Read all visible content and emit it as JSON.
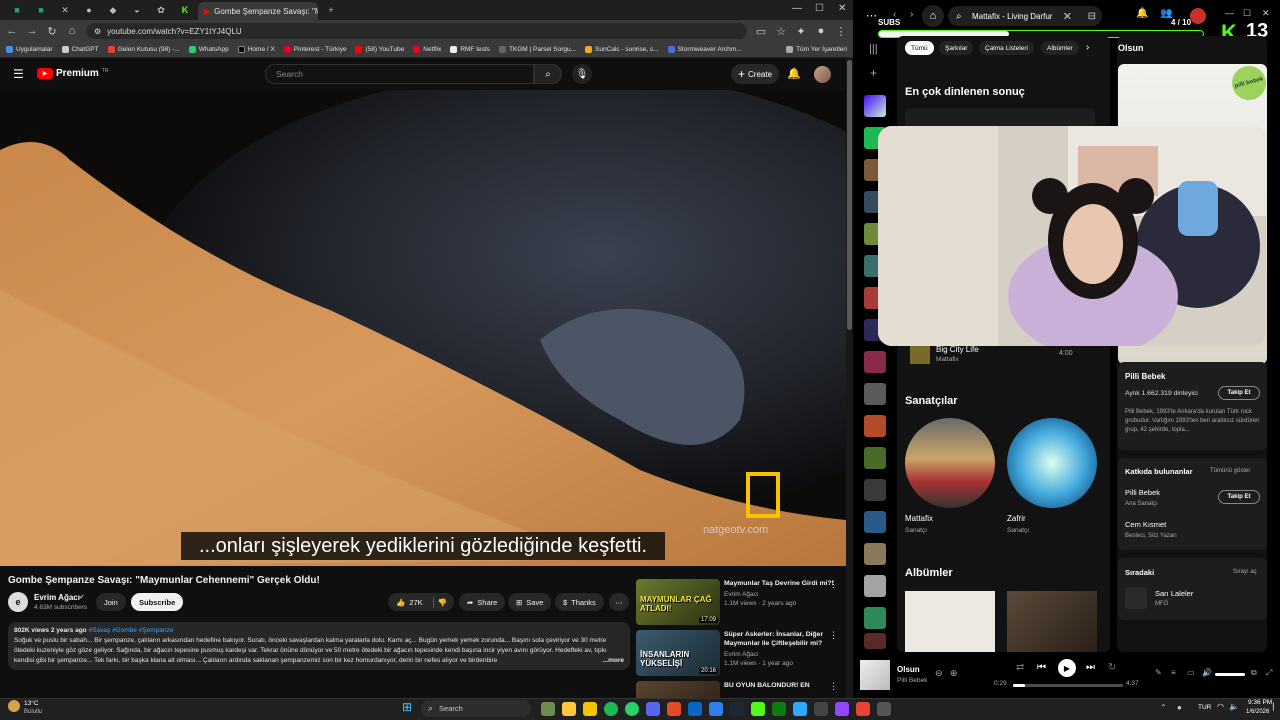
{
  "browser": {
    "tab_title": "Gombe Şempanze Savaşı: \"M",
    "url": "youtube.com/watch?v=EZY1tYJ4QLU",
    "bookmarks": [
      "Uygulamalar",
      "ChatGPT",
      "Gelen Kutusu (98) -...",
      "WhatsApp",
      "Home / X",
      "Pinterest - Türkiye",
      "(58) YouTube",
      "Netflix",
      "RMF tests",
      "TKGM | Parsel Sorgu...",
      "SunCalc - sunrise, s...",
      "Stormweaver Archm..."
    ],
    "all_bookmarks": "Tüm Yer İşaretleri"
  },
  "youtube": {
    "logo": "Premium",
    "logo_sup": "TR",
    "search_placeholder": "Search",
    "create_label": "Create",
    "subtitle": "...onları şişleyerek yediklerini gözlediğinde keşfetti.",
    "watermark": "natgeotv.com",
    "video_title": "Gombe Şempanze Savaşı: \"Maymunlar Cehennemi\" Gerçek Oldu!",
    "channel_name": "Evrim Ağacı",
    "channel_subs": "4.63M subscribers",
    "join_label": "Join",
    "subscribe_label": "Subscribe",
    "likes": "27K",
    "share_label": "Share",
    "save_label": "Save",
    "thanks_label": "Thanks",
    "desc_meta": "802K views  2 years ago",
    "desc_tags": "#Savaş #Gombe #Şempanze",
    "desc_body": "Soğuk ve puslu bir sabah... Bir şempanze, çalıların arkasından hedefine bakıyor. Suratı, önceki savaşlardan kalma yaralarla dolu. Kamı aç... Bugün yemek yemek zorunda... Başını sola çeviriyor ve 30 metre ötedeki kuzeniyle göz göze geliyor. Sağında, bir ağacın tepesine pusmuş kardeşi var. Tekrar önüne dönüyor ve 50 metre ötedeki bir ağacın tepesinde kendi başına incir yiyen avını görüyor. Hedefteki av, tıpkı kendisi gibi bir şempanze... Tek farkı, bir başka klana ait olması... Çalıların ardında saklanan şempanzemiz son bir kez homurdanıyor, derin bir nefes alıyor ve birdenbire",
    "desc_more": "...more",
    "recs": [
      {
        "thumb_text": "MAYMUNLAR ÇAĞ ATLADI!",
        "duration": "17:09",
        "title": "Maymunlar Taş Devrine Girdi mi?!",
        "channel": "Evrim Ağacı",
        "meta": "1.1M views · 2 years ago",
        "color": "#5a6b2a"
      },
      {
        "thumb_text": "İNSANLARIN YÜKSELİŞİ",
        "duration": "20:16",
        "title": "Süper Askerler: İnsanlar, Diğer Maymunlar ile Çiftleşebilir mi?",
        "channel": "Evrim Ağacı",
        "meta": "1.1M views · 1 year ago",
        "color": "#2e4a5c"
      },
      {
        "thumb_text": "",
        "duration": "",
        "title": "BU OYUN BALONDUR! EN",
        "channel": "",
        "meta": "",
        "color": "#4a3a2a"
      }
    ]
  },
  "overlay": {
    "subs_label": "SUBS",
    "subs_count": "4 / 10",
    "kick_count": "13",
    "subs_progress": 0.4
  },
  "spotify": {
    "search_value": "Mattafix - Living Darfur",
    "chips": [
      "Tümü",
      "Şarkılar",
      "Çalma Listeleri",
      "Albümler"
    ],
    "top_result_heading": "En çok dinlenen sonuç",
    "song_title": "Big City Life",
    "song_artist": "Mattafix",
    "song_duration": "4:00",
    "artists_heading": "Sanatçılar",
    "artists": [
      {
        "name": "Mattafix",
        "type": "Sanatçı"
      },
      {
        "name": "Zafrir",
        "type": "Sanatçı"
      }
    ],
    "albums_heading": "Albümler",
    "side_title": "Olsun",
    "side_brand": "pilli bebek",
    "band_name": "Pilli Bebek",
    "monthly_listeners": "Aylık 1.662.319 dinleyici",
    "follow_label": "Takip Et",
    "band_bio": "Pilli Bebek, 1993'te Ankara'da kurulan Türk rock grubudur. Varlığını 1993'ten beri aralıksız sürdüren grup, 42 şehirde, topla...",
    "contributors_heading": "Katkıda bulunanlar",
    "show_all": "Tümünü göster",
    "contributors": [
      {
        "name": "Pilli Bebek",
        "role": "Ana Sanatçı"
      },
      {
        "name": "Cem Kısmet",
        "role": "Besteci, Söz Yazarı"
      }
    ],
    "queue_heading": "Sıradaki",
    "queue_open": "Sırayı aç",
    "queue_track": "Sarı Laleler",
    "queue_artist": "MFÖ",
    "now_playing_title": "Olsun",
    "now_playing_artist": "Pilli Bebek",
    "time_elapsed": "0:29",
    "time_total": "4:37",
    "playback_progress": 0.105
  },
  "taskbar": {
    "temp": "13°C",
    "weather": "Bulutlu",
    "search": "Search",
    "lang": "TUR",
    "time": "9:36 PM",
    "date": "1/6/2026"
  }
}
